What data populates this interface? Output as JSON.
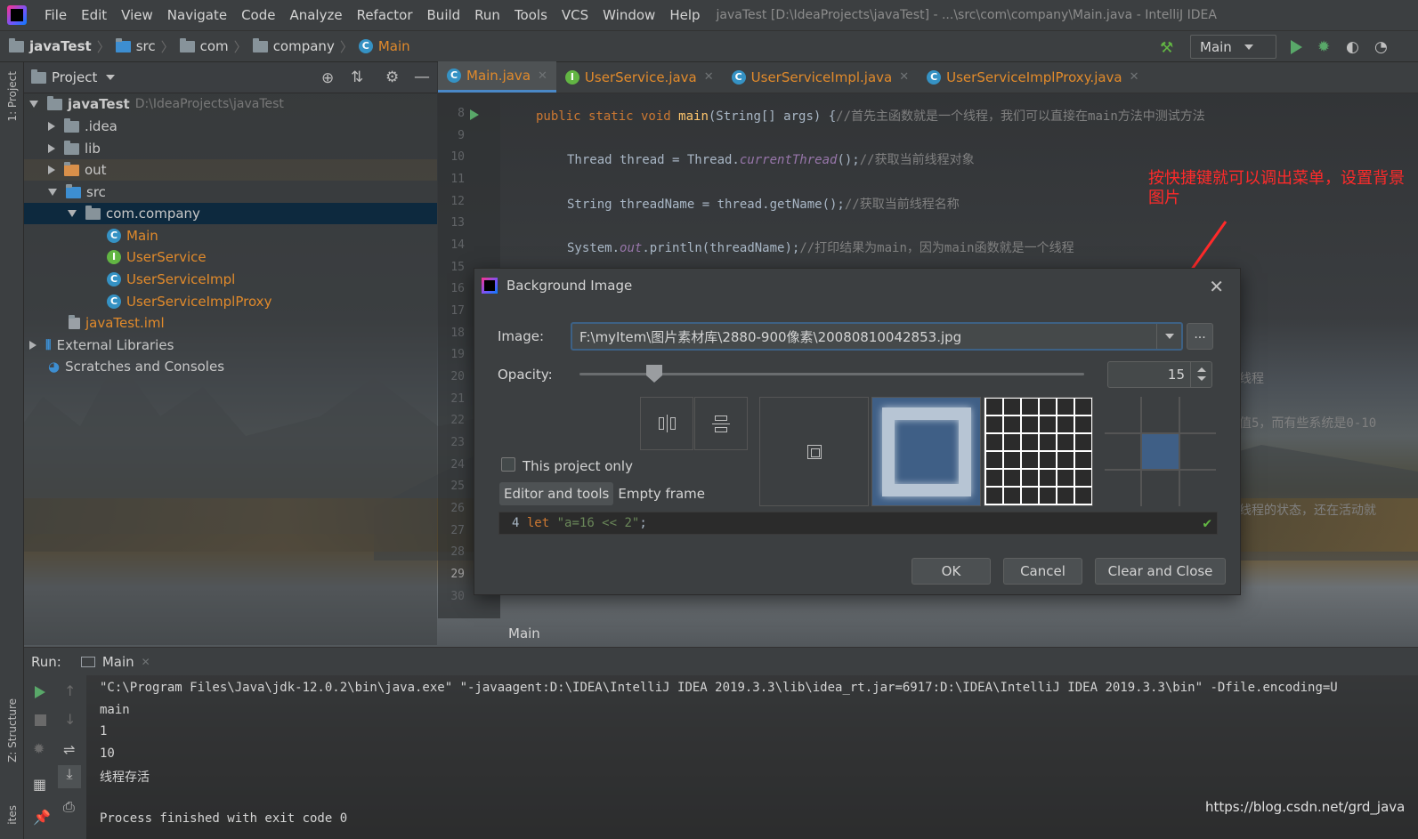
{
  "window": {
    "title": "javaTest [D:\\IdeaProjects\\javaTest] - ...\\src\\com\\company\\Main.java - IntelliJ IDEA",
    "menu": [
      "File",
      "Edit",
      "View",
      "Navigate",
      "Code",
      "Analyze",
      "Refactor",
      "Build",
      "Run",
      "Tools",
      "VCS",
      "Window",
      "Help"
    ]
  },
  "breadcrumb": [
    "javaTest",
    "src",
    "com",
    "company",
    "Main"
  ],
  "run_config": "Main",
  "left_strip": {
    "project_tab": "1: Project",
    "structure_tab": "Z: Structure",
    "favorites_tab": "ites"
  },
  "project_panel": {
    "title": "Project",
    "tree": [
      {
        "label": "javaTest",
        "path": "D:\\IdeaProjects\\javaTest"
      },
      {
        "label": ".idea"
      },
      {
        "label": "lib"
      },
      {
        "label": "out"
      },
      {
        "label": "src"
      },
      {
        "label": "com.company"
      },
      {
        "label": "Main"
      },
      {
        "label": "UserService"
      },
      {
        "label": "UserServiceImpl"
      },
      {
        "label": "UserServiceImplProxy"
      },
      {
        "label": "javaTest.iml"
      },
      {
        "label": "External Libraries"
      },
      {
        "label": "Scratches and Consoles"
      }
    ]
  },
  "editor": {
    "tabs": [
      "Main.java",
      "UserService.java",
      "UserServiceImpl.java",
      "UserServiceImplProxy.java"
    ],
    "line_numbers": [
      "8",
      "9",
      "10",
      "11",
      "12",
      "13",
      "14",
      "15",
      "16",
      "17",
      "18",
      "19",
      "20",
      "21",
      "22",
      "23",
      "24",
      "25",
      "26",
      "27",
      "28",
      "29",
      "30"
    ],
    "code": {
      "l8_kw": "public static void ",
      "l8_fn": "main",
      "l8_rest": "(String[] args) {",
      "l8_cm": "//首先主函数就是一个线程，我们可以直接在main方法中测试方法",
      "l10_a": "Thread thread = Thread.",
      "l10_it": "currentThread",
      "l10_b": "();",
      "l10_cm": "//获取当前线程对象",
      "l12_a": "String threadName = thread.getName();",
      "l12_cm": "//获取当前线程名称",
      "l14_a": "System.",
      "l14_it": "out",
      "l14_b": ".println(threadName);",
      "l14_cm": "//打印结果为main，因为main函数就是一个线程",
      "frag20": "线程",
      "frag22": "值5，而有些系统是0-10",
      "frag26": "线程的状态，还在活动就"
    },
    "footer": "Main"
  },
  "annotation": "按快捷键就可以调出菜单，设置背景图片",
  "dialog": {
    "title": "Background Image",
    "image_label": "Image:",
    "image_path": "F:\\myItem\\图片素材库\\2880-900像素\\20080810042853.jpg",
    "browse_label": "...",
    "opacity_label": "Opacity:",
    "opacity_value": "15",
    "opacity_fraction": 0.15,
    "this_project_only": "This project only",
    "seg_editor": "Editor and tools",
    "seg_empty": "Empty frame",
    "preview_num": "4",
    "preview_kw": "let",
    "preview_str": "\"a=16 << 2\"",
    "preview_end": ";",
    "ok": "OK",
    "cancel": "Cancel",
    "clear_close": "Clear and Close"
  },
  "run_panel": {
    "label": "Run:",
    "tab": "Main",
    "console": [
      "\"C:\\Program Files\\Java\\jdk-12.0.2\\bin\\java.exe\" \"-javaagent:D:\\IDEA\\IntelliJ IDEA 2019.3.3\\lib\\idea_rt.jar=6917:D:\\IDEA\\IntelliJ IDEA 2019.3.3\\bin\" -Dfile.encoding=U",
      "main",
      "1",
      "10",
      "线程存活",
      "",
      "Process finished with exit code 0"
    ]
  },
  "watermark": "https://blog.csdn.net/grd_java",
  "colors": {
    "accent": "#4a88c7",
    "annotation": "#ff2a2a",
    "file_modified": "#e18a2b",
    "selection": "#0d293e"
  }
}
